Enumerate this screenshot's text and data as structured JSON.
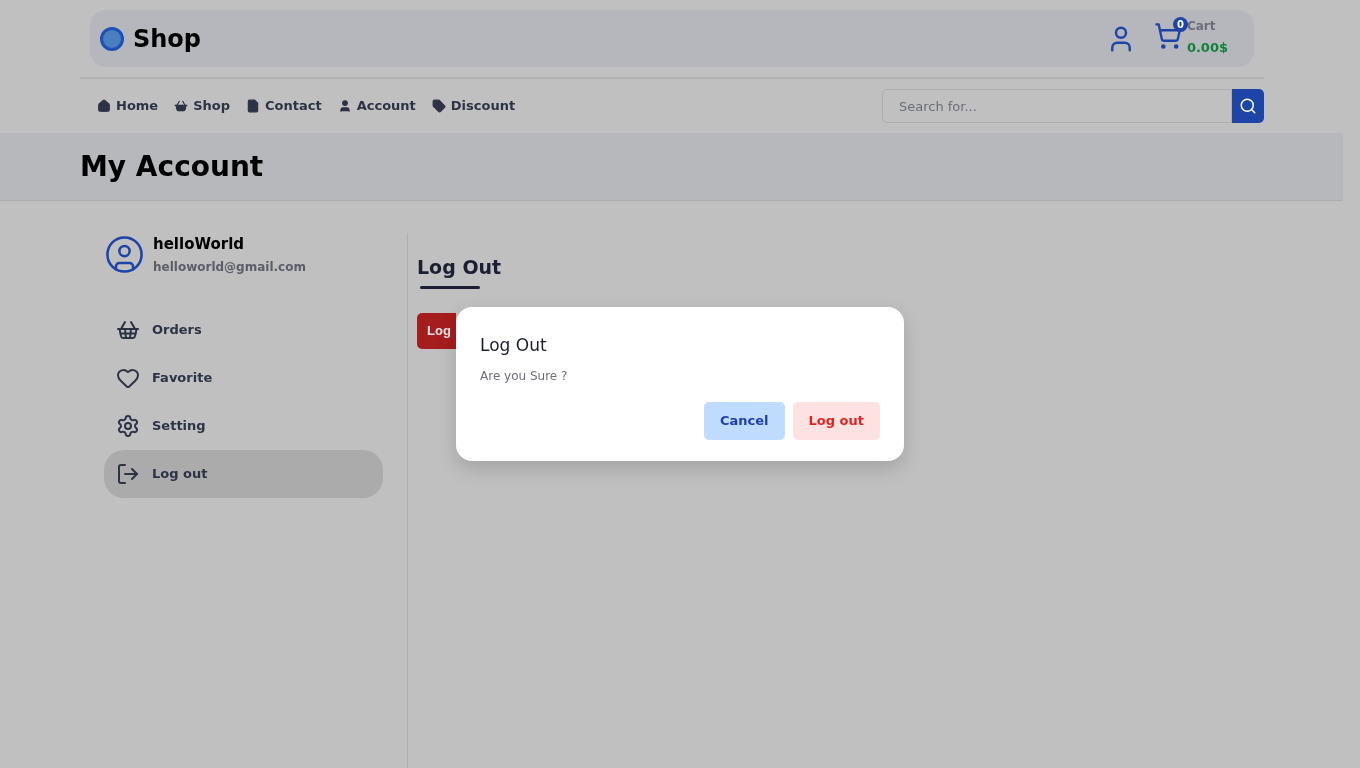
{
  "header": {
    "logo": "Shop",
    "cart": {
      "count": "0",
      "label": "Cart",
      "total": "0.00$"
    }
  },
  "nav": [
    {
      "kind": "home",
      "label": "Home"
    },
    {
      "kind": "shop",
      "label": "Shop"
    },
    {
      "kind": "contact",
      "label": "Contact"
    },
    {
      "kind": "account",
      "label": "Account"
    },
    {
      "kind": "discount",
      "label": "Discount"
    }
  ],
  "search": {
    "placeholder": "Search for..."
  },
  "page_title": "My Account",
  "user": {
    "name": "helloWorld",
    "email": "helloworld@gmail.com"
  },
  "sidebar": {
    "items": [
      {
        "kind": "orders",
        "label": "Orders",
        "selected": false
      },
      {
        "kind": "favorite",
        "label": "Favorite",
        "selected": false
      },
      {
        "kind": "setting",
        "label": "Setting",
        "selected": false
      },
      {
        "kind": "logout",
        "label": "Log out",
        "selected": true
      }
    ]
  },
  "content": {
    "title": "Log Out",
    "button": "Log"
  },
  "dialog": {
    "title": "Log Out",
    "message": "Are you Sure ?",
    "buttons": [
      {
        "kind": "cancel",
        "label": "Cancel"
      },
      {
        "kind": "confirm",
        "label": "Log out"
      }
    ]
  }
}
